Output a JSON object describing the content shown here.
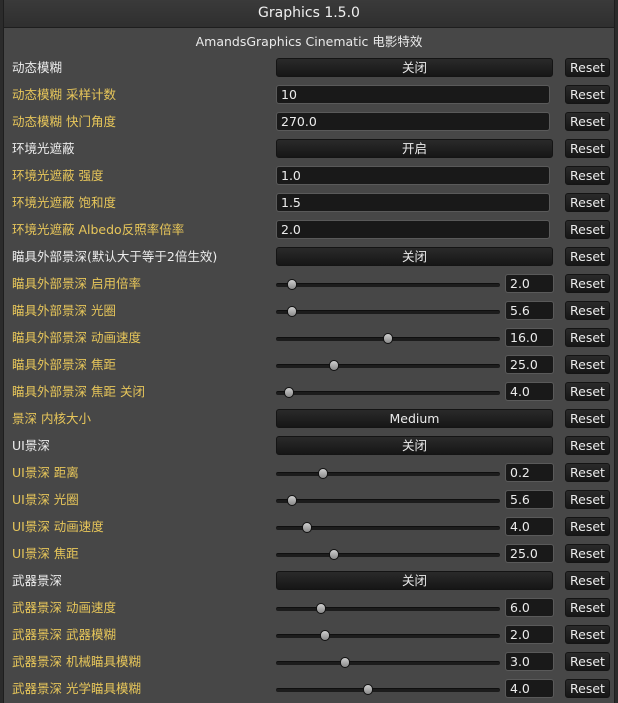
{
  "window": {
    "title": "Graphics 1.5.0"
  },
  "header": {
    "subtitle": "AmandsGraphics Cinematic 电影特效"
  },
  "reset_label": "Reset",
  "colors": {
    "accent_label": "#e7c65a",
    "plain_label": "#ececec"
  },
  "rows": [
    {
      "label": "动态模糊",
      "style": "white",
      "control": "toggle",
      "value": "关闭"
    },
    {
      "label": "动态模糊 采样计数",
      "style": "gold",
      "control": "input",
      "value": "10"
    },
    {
      "label": "动态模糊 快门角度",
      "style": "gold",
      "control": "input",
      "value": "270.0"
    },
    {
      "label": "环境光遮蔽",
      "style": "white",
      "control": "toggle",
      "value": "开启"
    },
    {
      "label": "环境光遮蔽 强度",
      "style": "gold",
      "control": "input",
      "value": "1.0"
    },
    {
      "label": "环境光遮蔽 饱和度",
      "style": "gold",
      "control": "input",
      "value": "1.5"
    },
    {
      "label": "环境光遮蔽 Albedo反照率倍率",
      "style": "gold",
      "control": "input",
      "value": "2.0"
    },
    {
      "label": "瞄具外部景深(默认大于等于2倍生效)",
      "style": "white",
      "control": "toggle",
      "value": "关闭"
    },
    {
      "label": "瞄具外部景深 启用倍率",
      "style": "gold",
      "control": "slider",
      "value": "2.0",
      "fraction": 0.07
    },
    {
      "label": "瞄具外部景深 光圈",
      "style": "gold",
      "control": "slider",
      "value": "5.6",
      "fraction": 0.07
    },
    {
      "label": "瞄具外部景深 动画速度",
      "style": "gold",
      "control": "slider",
      "value": "16.0",
      "fraction": 0.5
    },
    {
      "label": "瞄具外部景深 焦距",
      "style": "gold",
      "control": "slider",
      "value": "25.0",
      "fraction": 0.26
    },
    {
      "label": "瞄具外部景深 焦距 关闭",
      "style": "gold",
      "control": "slider",
      "value": "4.0",
      "fraction": 0.06
    },
    {
      "label": "景深 内核大小",
      "style": "gold",
      "control": "select",
      "value": "Medium"
    },
    {
      "label": "UI景深",
      "style": "white",
      "control": "toggle",
      "value": "关闭"
    },
    {
      "label": "UI景深 距离",
      "style": "gold",
      "control": "slider",
      "value": "0.2",
      "fraction": 0.21
    },
    {
      "label": "UI景深 光圈",
      "style": "gold",
      "control": "slider",
      "value": "5.6",
      "fraction": 0.07
    },
    {
      "label": "UI景深 动画速度",
      "style": "gold",
      "control": "slider",
      "value": "4.0",
      "fraction": 0.14
    },
    {
      "label": "UI景深 焦距",
      "style": "gold",
      "control": "slider",
      "value": "25.0",
      "fraction": 0.26
    },
    {
      "label": "武器景深",
      "style": "white",
      "control": "toggle",
      "value": "关闭"
    },
    {
      "label": "武器景深 动画速度",
      "style": "gold",
      "control": "slider",
      "value": "6.0",
      "fraction": 0.2
    },
    {
      "label": "武器景深 武器模糊",
      "style": "gold",
      "control": "slider",
      "value": "2.0",
      "fraction": 0.22
    },
    {
      "label": "武器景深 机械瞄具模糊",
      "style": "gold",
      "control": "slider",
      "value": "3.0",
      "fraction": 0.31
    },
    {
      "label": "武器景深 光学瞄具模糊",
      "style": "gold",
      "control": "slider",
      "value": "4.0",
      "fraction": 0.41
    }
  ]
}
